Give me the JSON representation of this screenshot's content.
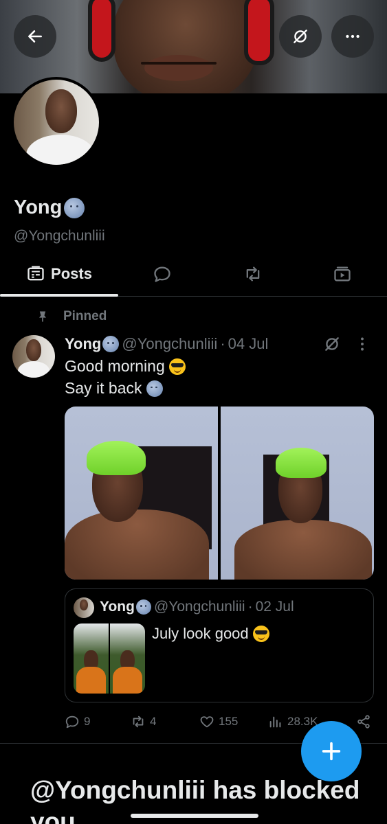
{
  "profile": {
    "display_name": "Yong",
    "handle": "@Yongchunliii"
  },
  "tabs": [
    {
      "label": "Posts",
      "icon": "posts-icon",
      "selected": true
    },
    {
      "label": "",
      "icon": "replies-icon"
    },
    {
      "label": "",
      "icon": "reposts-icon"
    },
    {
      "label": "",
      "icon": "media-icon"
    }
  ],
  "pinned_label": "Pinned",
  "post": {
    "name": "Yong",
    "handle": "@Yongchunliii",
    "separator": "·",
    "date": "04 Jul",
    "line1": "Good morning",
    "line2": "Say it back"
  },
  "quote": {
    "name": "Yong",
    "handle": "@Yongchunliii",
    "separator": "·",
    "date": "02 Jul",
    "text": "July look good"
  },
  "actions": {
    "replies": "9",
    "reposts": "4",
    "likes": "155",
    "views": "28.3K"
  },
  "blocked_text": "@Yongchunliii has blocked you",
  "colors": {
    "accent": "#1d9bf0",
    "muted": "#71767b",
    "text": "#e7e9ea",
    "background": "#000000"
  }
}
